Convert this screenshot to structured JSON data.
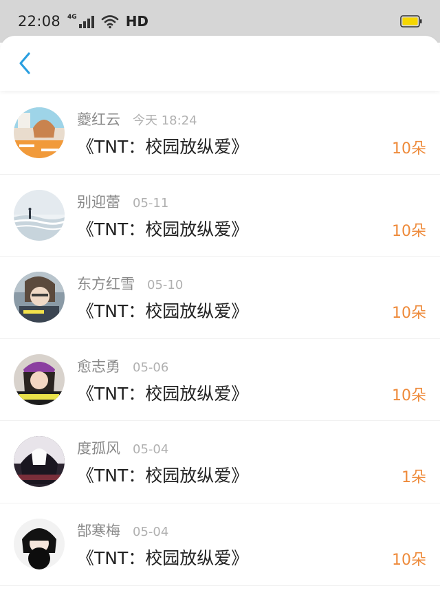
{
  "status_bar": {
    "time": "22:08",
    "network_tag": "4G",
    "hd_label": "HD",
    "icons": [
      "signal-icon",
      "wifi-icon",
      "battery-icon"
    ],
    "battery_color": "#f5d600"
  },
  "header": {
    "back_icon": "chevron-left-icon",
    "accent_color": "#2a9fe0"
  },
  "rewards": [
    {
      "name": "夔红云",
      "time": "今天 18:24",
      "book": "《TNT：校园放纵爱》",
      "amount": "10朵"
    },
    {
      "name": "别迎蕾",
      "time": "05-11",
      "book": "《TNT：校园放纵爱》",
      "amount": "10朵"
    },
    {
      "name": "东方红雪",
      "time": "05-10",
      "book": "《TNT：校园放纵爱》",
      "amount": "10朵"
    },
    {
      "name": "愈志勇",
      "time": "05-06",
      "book": "《TNT：校园放纵爱》",
      "amount": "10朵"
    },
    {
      "name": "度孤风",
      "time": "05-04",
      "book": "《TNT：校园放纵爱》",
      "amount": "1朵"
    },
    {
      "name": "郜寒梅",
      "time": "05-04",
      "book": "《TNT：校园放纵爱》",
      "amount": "10朵"
    }
  ],
  "colors": {
    "amount": "#ee8a3a",
    "name": "#8a8a8a",
    "time": "#b0b0b0"
  }
}
